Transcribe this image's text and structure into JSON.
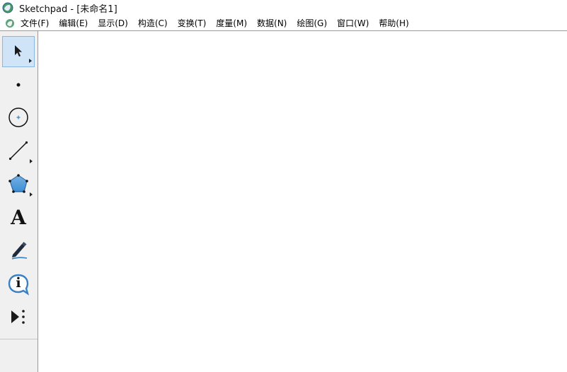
{
  "window": {
    "app_name": "Sketchpad",
    "document_title": " - [未命名1]"
  },
  "menu": [
    {
      "label": "文件(F)"
    },
    {
      "label": "编辑(E)"
    },
    {
      "label": "显示(D)"
    },
    {
      "label": "构造(C)"
    },
    {
      "label": "变换(T)"
    },
    {
      "label": "度量(M)"
    },
    {
      "label": "数据(N)"
    },
    {
      "label": "绘图(G)"
    },
    {
      "label": "窗口(W)"
    },
    {
      "label": "帮助(H)"
    }
  ],
  "toolbox": [
    {
      "icon": "arrow-select-icon",
      "selected": true,
      "has_submenu": true
    },
    {
      "icon": "point-icon",
      "selected": false,
      "has_submenu": false
    },
    {
      "icon": "compass-icon",
      "selected": false,
      "has_submenu": false
    },
    {
      "icon": "straightedge-icon",
      "selected": false,
      "has_submenu": true
    },
    {
      "icon": "polygon-icon",
      "selected": false,
      "has_submenu": true
    },
    {
      "icon": "text-icon",
      "selected": false,
      "has_submenu": false,
      "glyph": "A"
    },
    {
      "icon": "marker-icon",
      "selected": false,
      "has_submenu": false
    },
    {
      "icon": "information-icon",
      "selected": false,
      "has_submenu": false,
      "glyph": "i"
    },
    {
      "icon": "custom-tool-icon",
      "selected": false,
      "has_submenu": false
    }
  ],
  "colors": {
    "selected_tool_bg": "#cfe4f7",
    "polygon_fill": "#3d8fd6",
    "info_blue": "#3a7fc2"
  }
}
